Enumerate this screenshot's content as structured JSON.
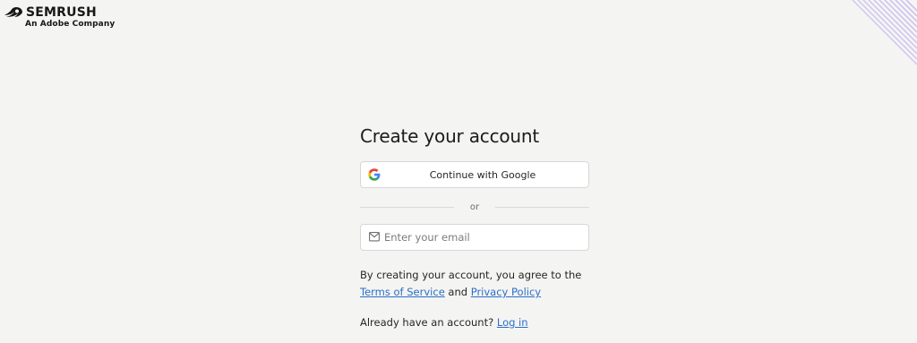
{
  "header": {
    "brand": "SEMRUSH",
    "tagline": "An Adobe Company"
  },
  "form": {
    "title": "Create your account",
    "google_label": "Continue with Google",
    "divider_text": "or",
    "email_placeholder": "Enter your email",
    "email_value": "",
    "agree_prefix": "By creating your account, you agree to the",
    "terms_label": "Terms of Service",
    "and_text": "and",
    "privacy_label": "Privacy Policy",
    "login_prompt": "Already have an account?",
    "login_label": "Log in"
  },
  "icons": {
    "logo": "semrush-flame-icon",
    "google": "google-g-icon",
    "email": "mail-icon"
  },
  "colors": {
    "background": "#f4f4f3",
    "link": "#2b6fc7",
    "border": "#d7d7d7",
    "accent_stripes": "#b9a4f0"
  }
}
